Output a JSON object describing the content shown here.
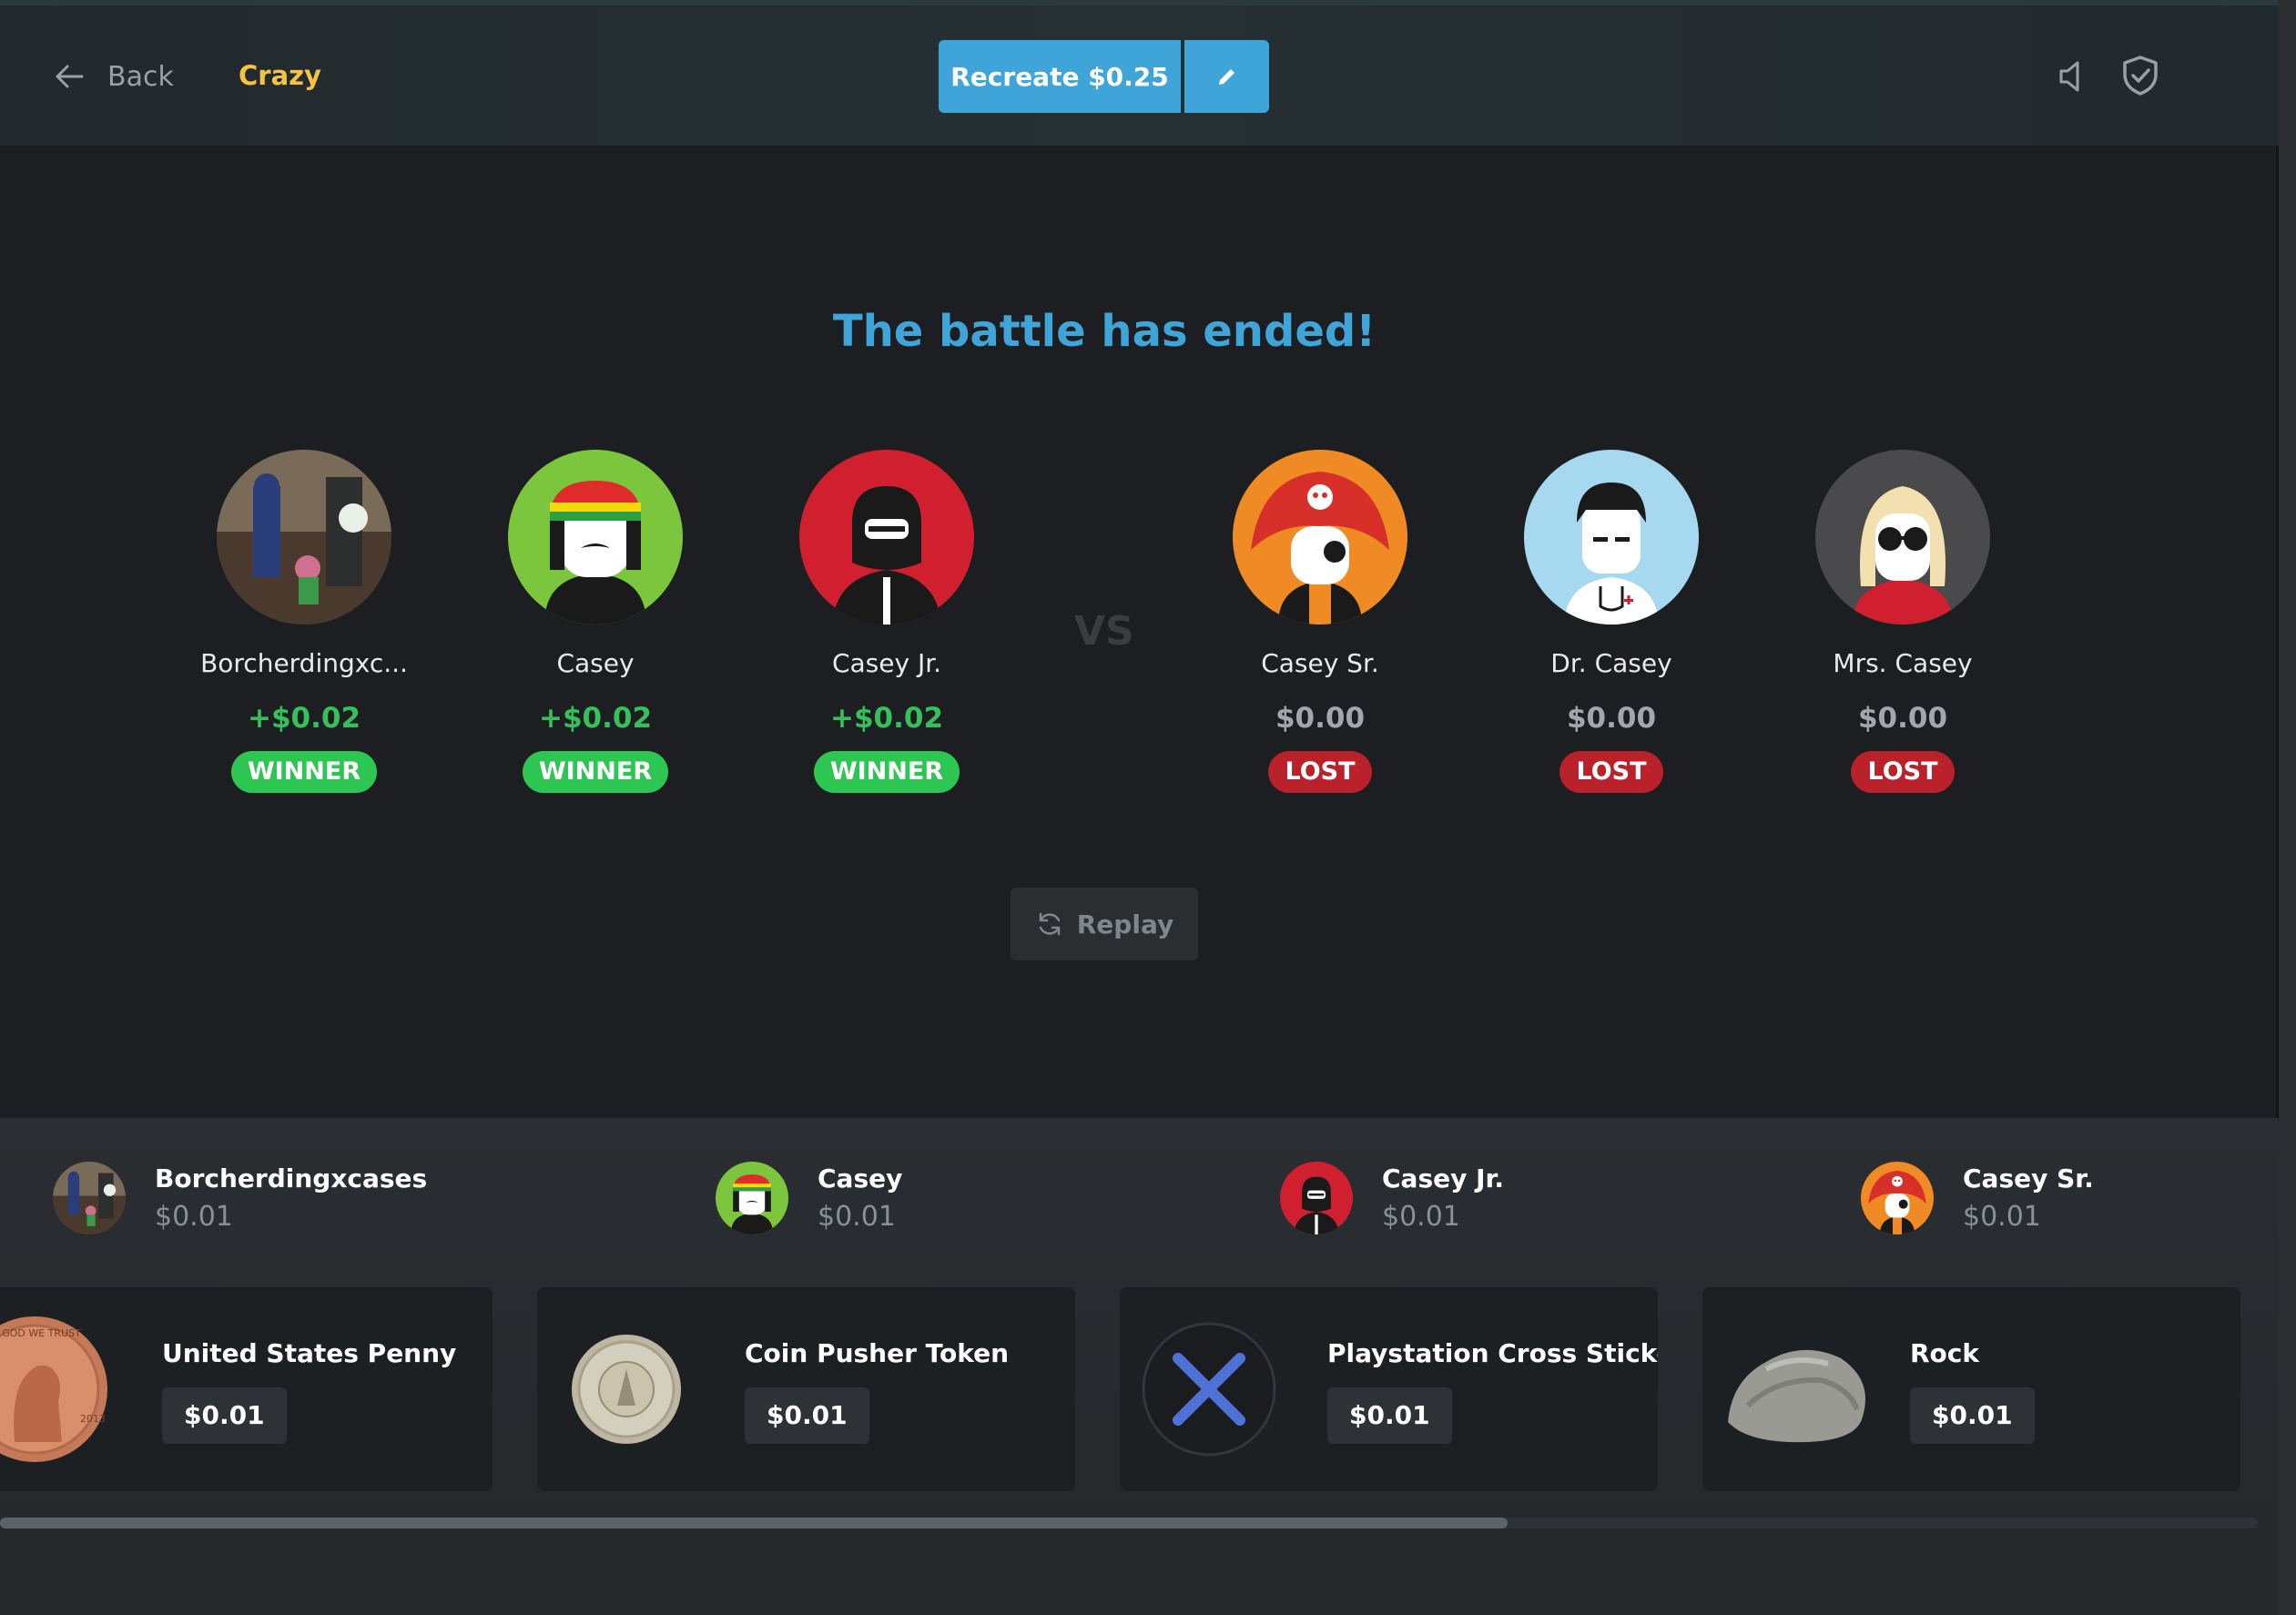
{
  "header": {
    "back_label": "Back",
    "mode_label": "Crazy",
    "recreate_label": "Recreate $0.25",
    "icons": [
      "arrow-left-icon",
      "pencil-icon",
      "sound-icon",
      "shield-check-icon"
    ]
  },
  "battle": {
    "headline": "The battle has ended!",
    "vs_label": "VS",
    "replay_label": "Replay",
    "players": [
      {
        "name": "Borcherdingxc...",
        "amount": "+$0.02",
        "status": "WINNER"
      },
      {
        "name": "Casey",
        "amount": "+$0.02",
        "status": "WINNER"
      },
      {
        "name": "Casey Jr.",
        "amount": "+$0.02",
        "status": "WINNER"
      },
      {
        "name": "Casey Sr.",
        "amount": "$0.00",
        "status": "LOST"
      },
      {
        "name": "Dr. Casey",
        "amount": "$0.00",
        "status": "LOST"
      },
      {
        "name": "Mrs. Casey",
        "amount": "$0.00",
        "status": "LOST"
      }
    ]
  },
  "drops": {
    "columns": [
      {
        "name": "Borcherdingxcases",
        "value": "$0.01",
        "item": {
          "name": "United States Penny",
          "value": "$0.01"
        }
      },
      {
        "name": "Casey",
        "value": "$0.01",
        "item": {
          "name": "Coin Pusher Token",
          "value": "$0.01"
        }
      },
      {
        "name": "Casey Jr.",
        "value": "$0.01",
        "item": {
          "name": "Playstation Cross Sticker",
          "value": "$0.01"
        }
      },
      {
        "name": "Casey Sr.",
        "value": "$0.01",
        "item": {
          "name": "Rock",
          "value": "$0.01"
        }
      }
    ]
  },
  "colors": {
    "accent": "#3fa4d8",
    "mode": "#f4c342",
    "win": "#2dc653",
    "loss": "#b9222b"
  }
}
